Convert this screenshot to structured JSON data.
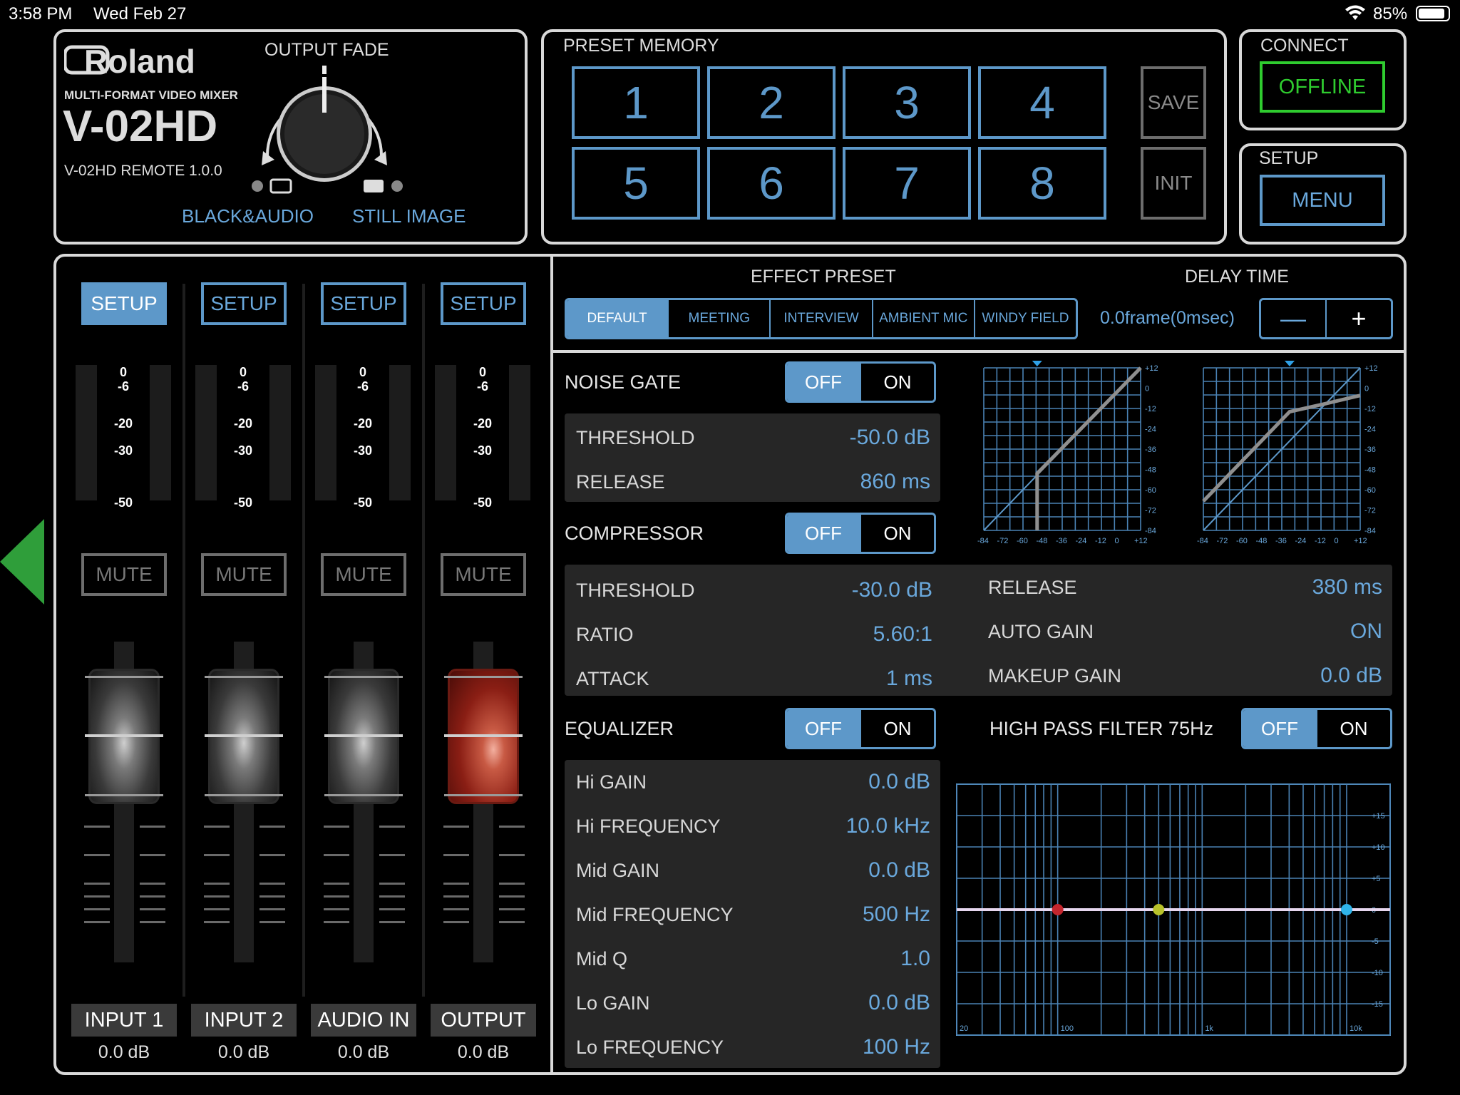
{
  "status_bar": {
    "time": "3:58 PM",
    "date": "Wed Feb 27",
    "battery": "85%"
  },
  "device": {
    "brand": "Roland",
    "subtitle": "MULTI-FORMAT VIDEO MIXER",
    "model": "V-02HD",
    "version": "V-02HD REMOTE 1.0.0"
  },
  "output_fade": {
    "title": "OUTPUT FADE",
    "left_label": "BLACK&AUDIO",
    "right_label": "STILL IMAGE"
  },
  "preset_memory": {
    "title": "PRESET MEMORY",
    "buttons": [
      "1",
      "2",
      "3",
      "4",
      "5",
      "6",
      "7",
      "8"
    ],
    "save_label": "SAVE",
    "init_label": "INIT"
  },
  "connect": {
    "title": "CONNECT",
    "status": "OFFLINE"
  },
  "setup": {
    "title": "SETUP",
    "menu_label": "MENU"
  },
  "mixer": {
    "setup_label": "SETUP",
    "mute_label": "MUTE",
    "scale": [
      "0",
      "-6",
      "-20",
      "-30",
      "-50"
    ],
    "channels": [
      {
        "name": "INPUT 1",
        "level": "0.0 dB"
      },
      {
        "name": "INPUT 2",
        "level": "0.0 dB"
      },
      {
        "name": "AUDIO IN",
        "level": "0.0 dB"
      },
      {
        "name": "OUTPUT",
        "level": "0.0 dB"
      }
    ]
  },
  "effect_preset": {
    "title": "EFFECT PRESET",
    "options": [
      "DEFAULT",
      "MEETING",
      "INTERVIEW",
      "AMBIENT MIC",
      "WINDY FIELD"
    ],
    "selected": "DEFAULT"
  },
  "delay_time": {
    "title": "DELAY TIME",
    "value": "0.0frame(0msec)",
    "minus": "—",
    "plus": "+"
  },
  "toggle": {
    "off": "OFF",
    "on": "ON"
  },
  "noise_gate": {
    "label": "NOISE GATE",
    "state": "OFF",
    "threshold_label": "THRESHOLD",
    "threshold": "-50.0 dB",
    "release_label": "RELEASE",
    "release": "860 ms"
  },
  "compressor": {
    "label": "COMPRESSOR",
    "state": "OFF",
    "threshold_label": "THRESHOLD",
    "threshold": "-30.0 dB",
    "ratio_label": "RATIO",
    "ratio": "5.60:1",
    "attack_label": "ATTACK",
    "attack": "1 ms",
    "release_label": "RELEASE",
    "release": "380 ms",
    "auto_gain_label": "AUTO GAIN",
    "auto_gain": "ON",
    "makeup_gain_label": "MAKEUP GAIN",
    "makeup_gain": "0.0 dB"
  },
  "equalizer": {
    "label": "EQUALIZER",
    "state": "OFF",
    "hpf_label": "HIGH PASS FILTER 75Hz",
    "hpf_state": "OFF",
    "params": [
      {
        "label": "Hi GAIN",
        "value": "0.0 dB"
      },
      {
        "label": "Hi FREQUENCY",
        "value": "10.0 kHz"
      },
      {
        "label": "Mid GAIN",
        "value": "0.0 dB"
      },
      {
        "label": "Mid FREQUENCY",
        "value": "500 Hz"
      },
      {
        "label": "Mid Q",
        "value": "1.0"
      },
      {
        "label": "Lo GAIN",
        "value": "0.0 dB"
      },
      {
        "label": "Lo FREQUENCY",
        "value": "100 Hz"
      }
    ]
  },
  "dyn_graph": {
    "y_ticks": [
      "+12",
      "0",
      "-12",
      "-24",
      "-36",
      "-48",
      "-60",
      "-72",
      "-84"
    ],
    "x_ticks": [
      "-84",
      "-72",
      "-60",
      "-48",
      "-36",
      "-24",
      "-12",
      "0",
      "+12"
    ]
  },
  "eq_graph": {
    "y_ticks": [
      "+15",
      "+10",
      "+5",
      "0",
      "-5",
      "-10",
      "-15"
    ],
    "x_ticks": [
      "20",
      "100",
      "1k",
      "10k"
    ],
    "colors": {
      "lo": "#c4262e",
      "mid": "#b8c22a",
      "hi": "#2fb4ea",
      "curve": "#e6d6ee"
    }
  },
  "colors": {
    "accent": "#5d98c9",
    "offline": "#2fcc2f",
    "nav_arrow": "#2f9e3a"
  }
}
